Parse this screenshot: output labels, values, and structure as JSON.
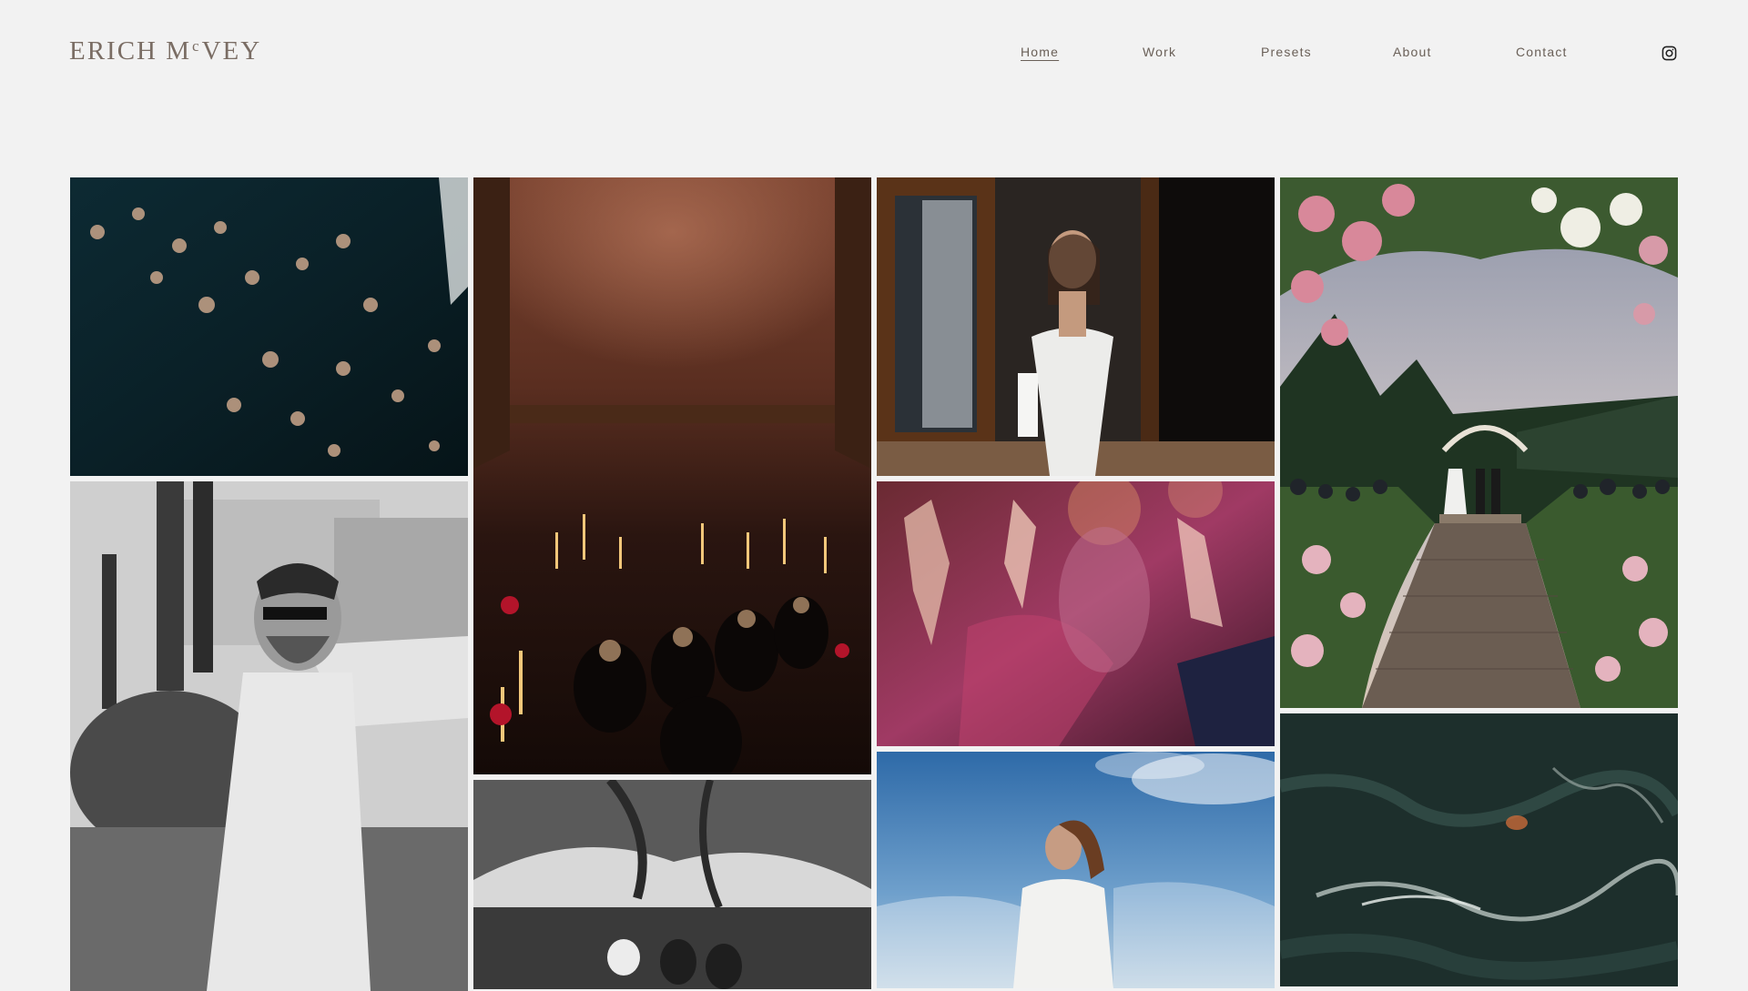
{
  "brand": {
    "logo_text_left": "ERICH M",
    "logo_text_sup": "c",
    "logo_text_right": "VEY"
  },
  "nav": {
    "items": [
      {
        "label": "Home",
        "active": true
      },
      {
        "label": "Work",
        "active": false
      },
      {
        "label": "Presets",
        "active": false
      },
      {
        "label": "About",
        "active": false
      },
      {
        "label": "Contact",
        "active": false
      }
    ],
    "social_icon": "instagram-icon"
  },
  "colors": {
    "background": "#f2f2f2",
    "logo": "#7a6d64",
    "nav_text": "#6a6058"
  }
}
